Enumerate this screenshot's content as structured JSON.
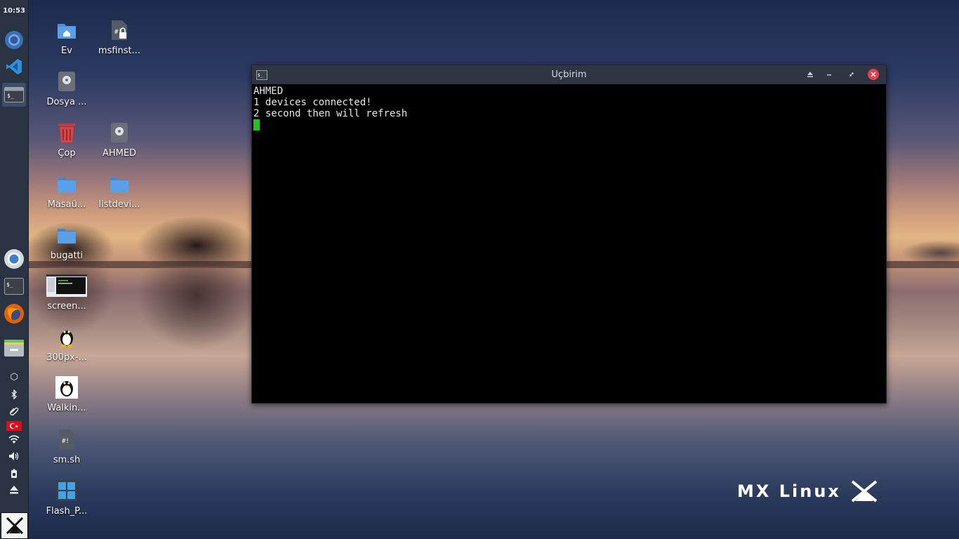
{
  "panel": {
    "clock": "10:53",
    "apps": [
      {
        "name": "browser-launcher",
        "icon": "chromium-icon"
      },
      {
        "name": "editor-launcher",
        "icon": "vscode-icon"
      },
      {
        "name": "terminal-task",
        "icon": "terminal-icon",
        "active": true
      }
    ],
    "favorites": [
      {
        "name": "chromium-launcher",
        "icon": "chromium-icon"
      },
      {
        "name": "terminal-launcher",
        "icon": "terminal-icon"
      },
      {
        "name": "firefox-launcher",
        "icon": "firefox-icon"
      },
      {
        "name": "file-manager-launcher",
        "icon": "file-manager-icon"
      }
    ],
    "tray": [
      "package-icon",
      "bluetooth-icon",
      "clip-icon",
      "flag-tr-icon",
      "wifi-icon",
      "volume-icon",
      "battery-icon",
      "eject-icon"
    ],
    "start_button_icon": "mx-logo-icon"
  },
  "desktop": {
    "icons": [
      {
        "label": "Ev",
        "icon": "home-folder-icon"
      },
      {
        "label": "msfinst...",
        "icon": "locked-script-icon"
      },
      {
        "label": "Dosya ...",
        "icon": "drive-icon"
      },
      {
        "label": "Çop",
        "icon": "trash-icon"
      },
      {
        "label": "AHMED",
        "icon": "drive-icon"
      },
      {
        "label": "Masaü...",
        "icon": "folder-icon"
      },
      {
        "label": "listdevi...",
        "icon": "folder-icon"
      },
      {
        "label": "bugatti",
        "icon": "folder-icon"
      },
      {
        "label": "screen...",
        "icon": "screenshot-thumbnail-icon"
      },
      {
        "label": "300px-...",
        "icon": "tux-icon"
      },
      {
        "label": "Walkin...",
        "icon": "tux-image-icon"
      },
      {
        "label": "sm.sh",
        "icon": "script-icon"
      },
      {
        "label": "Flash_P...",
        "icon": "app-grid-icon"
      }
    ]
  },
  "terminal": {
    "title": "Uçbirim",
    "lines": [
      "AHMED",
      "1 devices connected!",
      "2 second then will refresh"
    ]
  },
  "wallpaper_logo": "MX Linux",
  "colors": {
    "panel_bg": "#2a3342",
    "titlebar_bg": "#2f3542",
    "close_button": "#e0414f",
    "cursor": "#1ec51e",
    "folder_blue": "#4a90d9"
  }
}
